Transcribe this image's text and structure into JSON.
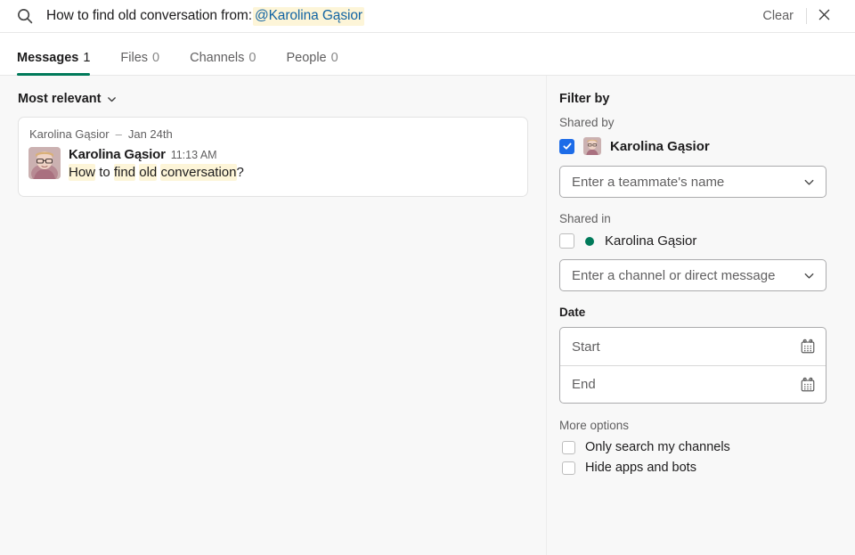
{
  "search": {
    "query_plain": "How to find old conversation from:",
    "query_token": "@Karolina Gąsior",
    "clear_label": "Clear",
    "icons": {
      "search": "search-icon",
      "close": "close-icon"
    }
  },
  "tabs": [
    {
      "label": "Messages",
      "count": "1",
      "active": true
    },
    {
      "label": "Files",
      "count": "0",
      "active": false
    },
    {
      "label": "Channels",
      "count": "0",
      "active": false
    },
    {
      "label": "People",
      "count": "0",
      "active": false
    }
  ],
  "results": {
    "sort_label": "Most relevant",
    "items": [
      {
        "channel": "Karolina Gąsior",
        "separator": "–",
        "date": "Jan 24th",
        "author": "Karolina Gąsior",
        "time": "11:13 AM",
        "text_parts": [
          {
            "t": "How",
            "hl": true
          },
          {
            "t": " ",
            "hl": false
          },
          {
            "t": "to",
            "hl": false
          },
          {
            "t": " ",
            "hl": false
          },
          {
            "t": "find",
            "hl": true
          },
          {
            "t": " ",
            "hl": false
          },
          {
            "t": "old",
            "hl": true
          },
          {
            "t": " ",
            "hl": false
          },
          {
            "t": "conversation",
            "hl": true
          },
          {
            "t": "?",
            "hl": false
          }
        ]
      }
    ]
  },
  "filters": {
    "title": "Filter by",
    "shared_by": {
      "label": "Shared by",
      "person": "Karolina Gąsior",
      "checked": true,
      "placeholder": "Enter a teammate's name"
    },
    "shared_in": {
      "label": "Shared in",
      "person": "Karolina Gąsior",
      "checked": false,
      "placeholder": "Enter a channel or direct message"
    },
    "date": {
      "label": "Date",
      "start_placeholder": "Start",
      "end_placeholder": "End"
    },
    "more_options": {
      "label": "More options",
      "options": [
        {
          "label": "Only search my channels",
          "checked": false
        },
        {
          "label": "Hide apps and bots",
          "checked": false
        }
      ]
    }
  },
  "colors": {
    "accent_green": "#007a5a",
    "checkbox_blue": "#1d6ce8",
    "highlight_yellow": "#fdf5d8",
    "link_blue": "#1264a3",
    "background": "#f8f8f8"
  }
}
